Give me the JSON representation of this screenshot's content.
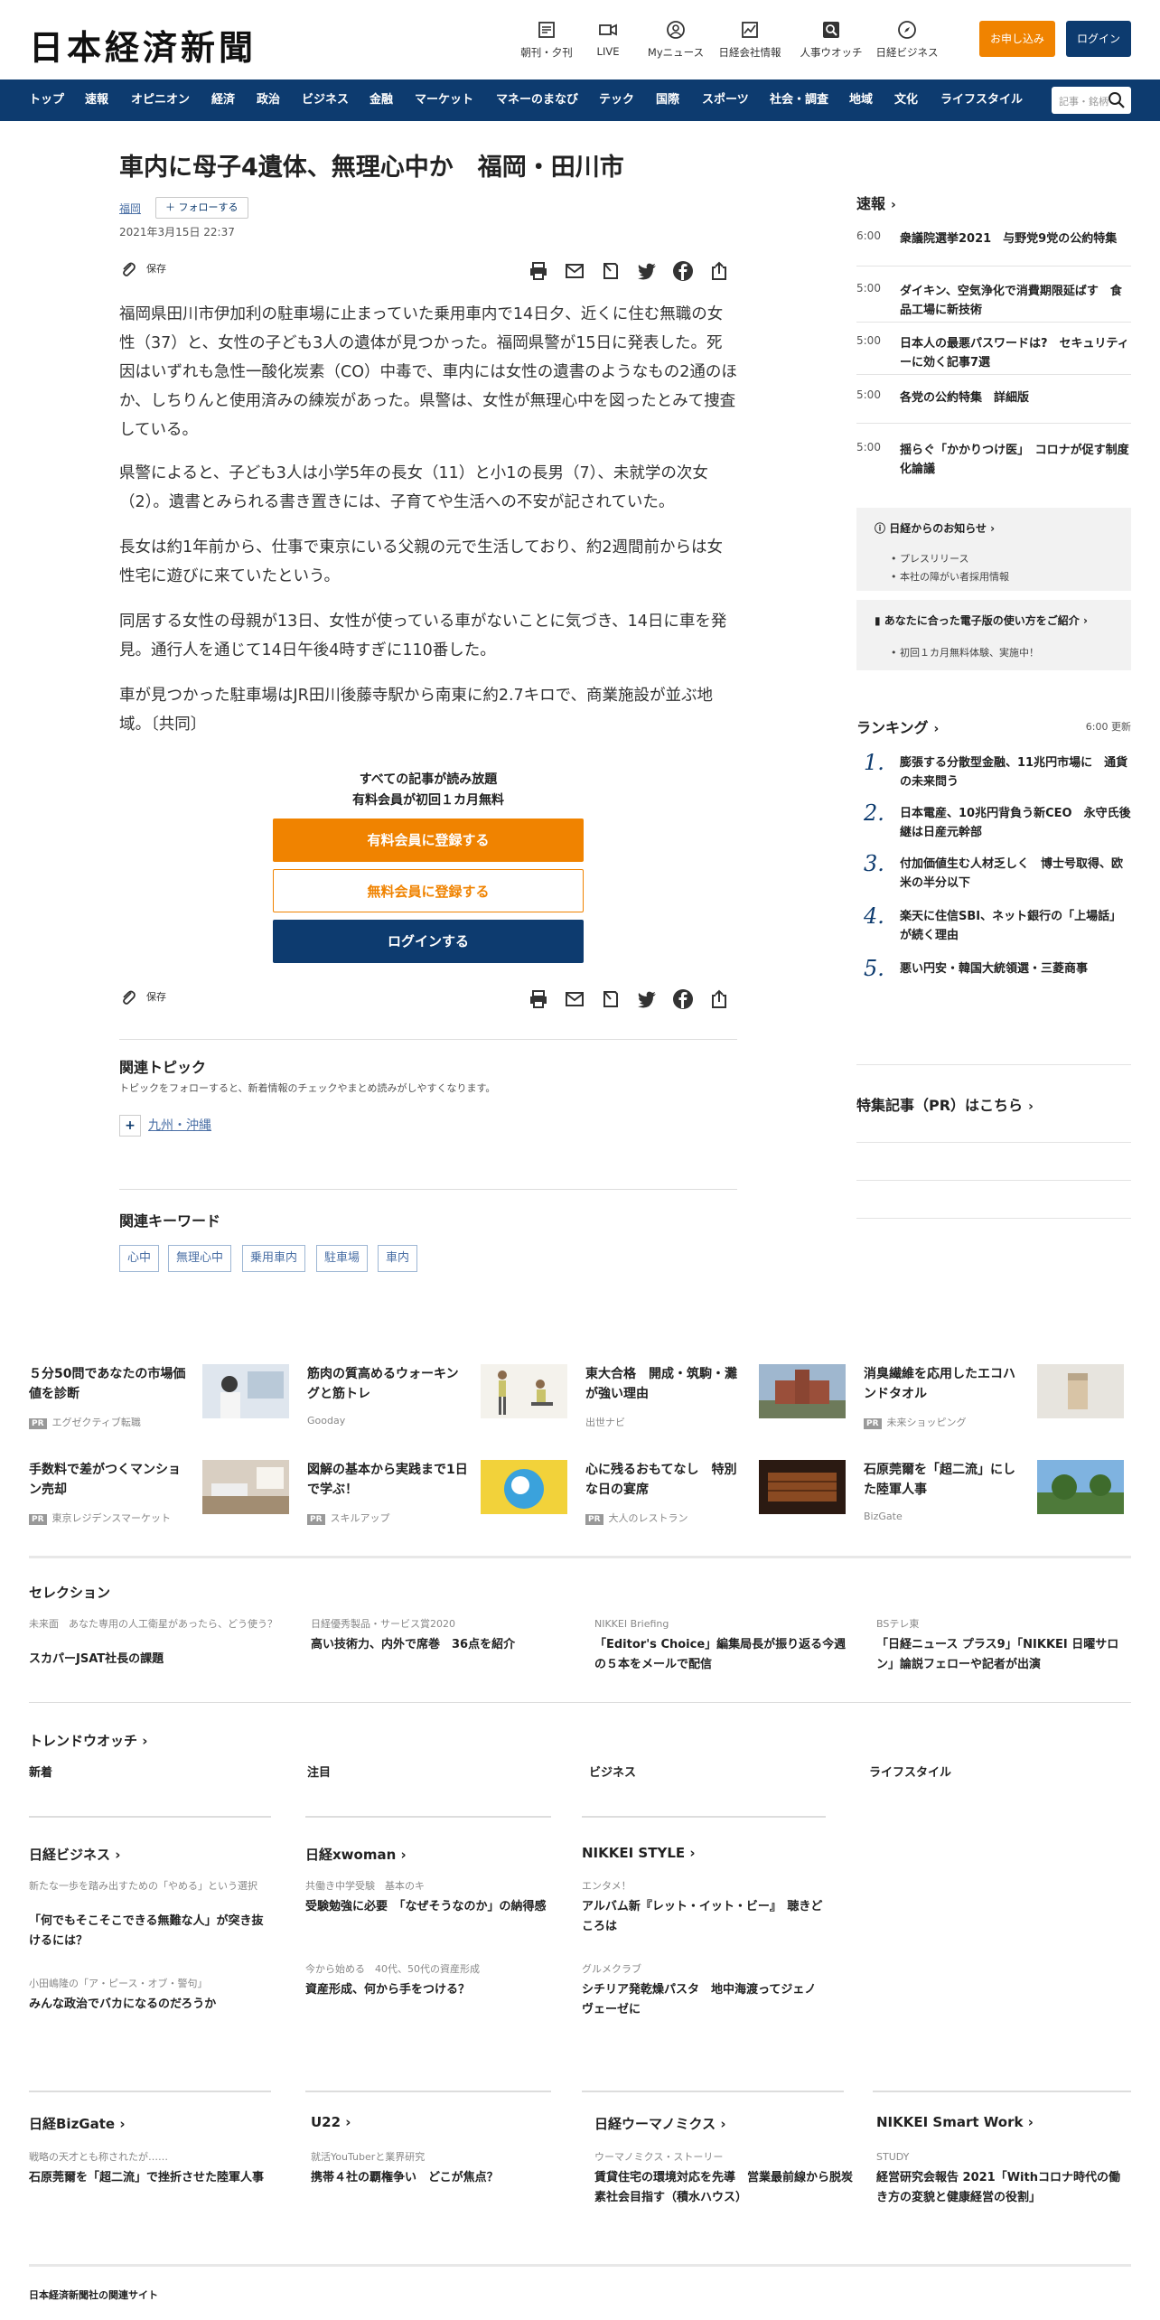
{
  "header": {
    "logo": "日本経済新聞",
    "icons": [
      {
        "label": "朝刊・夕刊",
        "icon": "newspaper-icon"
      },
      {
        "label": "LIVE",
        "icon": "video-icon"
      },
      {
        "label": "Myニュース",
        "icon": "user-icon"
      },
      {
        "label": "日経会社情報",
        "icon": "chart-icon"
      },
      {
        "label": "人事ウオッチ",
        "icon": "search-person-icon"
      },
      {
        "label": "日経ビジネス",
        "icon": "compass-icon"
      }
    ],
    "subscribe_label": "お申し込み",
    "login_label": "ログイン"
  },
  "nav": {
    "items": [
      "トップ",
      "速報",
      "オピニオン",
      "経済",
      "政治",
      "ビジネス",
      "金融",
      "マーケット",
      "マネーのまなび",
      "テック",
      "国際",
      "スポーツ",
      "社会・調査",
      "地域",
      "文化",
      "ライフスタイル"
    ],
    "search_placeholder": "記事・銘柄"
  },
  "article": {
    "title": "車内に母子4遺体、無理心中か　福岡・田川市",
    "area": "福岡",
    "follow_label": "＋ フォローする",
    "date": "2021年3月15日 22:37",
    "save_label": "保存",
    "paragraphs": [
      "福岡県田川市伊加利の駐車場に止まっていた乗用車内で14日夕、近くに住む無職の女性（37）と、女性の子ども3人の遺体が見つかった。福岡県警が15日に発表した。死因はいずれも急性一酸化炭素（CO）中毒で、車内には女性の遺書のようなもの2通のほか、しちりんと使用済みの練炭があった。県警は、女性が無理心中を図ったとみて捜査している。",
      "県警によると、子ども3人は小学5年の長女（11）と小1の長男（7）、未就学の次女（2）。遺書とみられる書き置きには、子育てや生活への不安が記されていた。",
      "長女は約1年前から、仕事で東京にいる父親の元で生活しており、約2週間前からは女性宅に遊びに来ていたという。",
      "同居する女性の母親が13日、女性が使っている車がないことに気づき、14日に車を発見。通行人を通じて14日午後4時すぎに110番した。",
      "車が見つかった駐車場はJR田川後藤寺駅から南東に約2.7キロで、商業施設が並ぶ地域。〔共同〕"
    ],
    "paywall": {
      "line1": "すべての記事が読み放題",
      "line2": "有料会員が初回１カ月無料",
      "paid_button": "有料会員に登録する",
      "free_button": "無料会員に登録する",
      "login_button": "ログインする"
    },
    "related_topic": {
      "heading": "関連トピック",
      "sub": "トピックをフォローすると、新着情報のチェックやまとめ読みがしやすくなります。",
      "topic": "九州・沖縄"
    },
    "keywords": {
      "heading": "関連キーワード",
      "items": [
        "心中",
        "無理心中",
        "乗用車内",
        "駐車場",
        "車内"
      ]
    }
  },
  "sidebar": {
    "breaking_heading": "速報",
    "breaking": [
      {
        "time": "6:00",
        "text": "衆議院選挙2021　与野党9党の公約特集"
      },
      {
        "time": "5:00",
        "text": "ダイキン、空気浄化で消費期限延ばす　食品工場に新技術"
      },
      {
        "time": "5:00",
        "text": "日本人の最悪パスワードは?　セキュリティーに効く記事7選"
      },
      {
        "time": "5:00",
        "text": "各党の公約特集　詳細版"
      },
      {
        "time": "5:00",
        "text": "揺らぐ「かかりつけ医」　コロナが促す制度化論議"
      }
    ],
    "notice": {
      "heading": "日経からのお知らせ",
      "items": [
        "プレスリリース",
        "本社の障がい者採用情報"
      ]
    },
    "ebook": {
      "heading": "あなたに合った電子版の使い方をご紹介",
      "items": [
        "初回１カ月無料体験、実施中！"
      ]
    },
    "ranking_heading": "ランキング",
    "ranking_time": "6:00 更新",
    "ranking": [
      {
        "n": "1.",
        "text": "膨張する分散型金融、11兆円市場に　通貨の未来問う"
      },
      {
        "n": "2.",
        "text": "日本電産、10兆円背負う新CEO　永守氏後継は日産元幹部"
      },
      {
        "n": "3.",
        "text": "付加価値生む人材乏しく　博士号取得、欧米の半分以下"
      },
      {
        "n": "4.",
        "text": "楽天に住信SBI、ネット銀行の「上場話」が続く理由"
      },
      {
        "n": "5.",
        "text": "悪い円安・韓国大統領選・三菱商事"
      }
    ],
    "pr_heading": "特集記事（PR）はこちら"
  },
  "ads": [
    {
      "text": "５分50問であなたの市場価値を診断",
      "source": "エグゼクティブ転職",
      "pr": true
    },
    {
      "text": "筋肉の質高めるウォーキングと筋トレ",
      "source": "Gooday",
      "pr": false
    },
    {
      "text": "東大合格　開成・筑駒・灘が強い理由",
      "source": "出世ナビ",
      "pr": false
    },
    {
      "text": "消臭繊維を応用したエコハンドタオル",
      "source": "未来ショッピング",
      "pr": true
    },
    {
      "text": "手数料で差がつくマンション売却",
      "source": "東京レジデンスマーケット",
      "pr": true
    },
    {
      "text": "図解の基本から実践まで1日で学ぶ！",
      "source": "スキルアップ",
      "pr": true
    },
    {
      "text": "心に残るおもてなし　特別な日の宴席",
      "source": "大人のレストラン",
      "pr": true
    },
    {
      "text": "石原莞爾を「超二流」にした陸軍人事",
      "source": "BizGate",
      "pr": false
    }
  ],
  "selection": {
    "heading": "セレクション",
    "items": [
      {
        "sub": "未来面　あなた専用の人工衛星があったら、どう使う？",
        "title": "スカパーJSAT社長の課題"
      },
      {
        "sub": "日経優秀製品・サービス賞2020",
        "title": "高い技術力、内外で席巻　36点を紹介"
      },
      {
        "sub": "NIKKEI Briefing",
        "title": "「Editor's Choice」編集局長が振り返る今週の５本をメールで配信"
      },
      {
        "sub": "BSテレ東",
        "title": "「日経ニュース プラス9」「NIKKEI 日曜サロン」論説フェローや記者が出演"
      }
    ]
  },
  "trend": {
    "heading": "トレンドウオッチ",
    "tabs": [
      "新着",
      "注目",
      "ビジネス",
      "ライフスタイル"
    ]
  },
  "brands1": [
    {
      "name": "日経ビジネス",
      "items": [
        {
          "sub": "新たな一歩を踏み出すための「やめる」という選択",
          "title": "「何でもそこそこできる無難な人」が突き抜けるには？"
        },
        {
          "sub": "小田嶋隆の「ア・ピース・オブ・警句」",
          "title": "みんな政治でバカになるのだろうか"
        }
      ]
    },
    {
      "name": "日経xwoman",
      "items": [
        {
          "sub": "共働き中学受験　基本のキ",
          "title": "受験勉強に必要　「なぜそうなのか」の納得感"
        },
        {
          "sub": "今から始める　40代、50代の資産形成",
          "title": "資産形成、何から手をつける？"
        }
      ]
    },
    {
      "name": "NIKKEI STYLE",
      "items": [
        {
          "sub": "エンタメ！",
          "title": "アルバム新『レット・イット・ビー』　聴きどころは"
        },
        {
          "sub": "グルメクラブ",
          "title": "シチリア発乾燥パスタ　地中海渡ってジェノヴェーゼに"
        }
      ]
    }
  ],
  "brands2": [
    {
      "name": "日経BizGate",
      "sub": "戦略の天才とも称されたが……",
      "title": "石原莞爾を「超二流」で挫折させた陸軍人事"
    },
    {
      "name": "U22",
      "sub": "就活YouTuberと業界研究",
      "title": "携帯４社の覇権争い　どこが焦点？"
    },
    {
      "name": "日経ウーマノミクス",
      "sub": "ウーマノミクス・ストーリー",
      "title": "賃貸住宅の環境対応を先導　営業最前線から脱炭素社会目指す（積水ハウス）"
    },
    {
      "name": "NIKKEI Smart Work",
      "sub": "STUDY",
      "title": "経営研究会報告 2021「Withコロナ時代の働き方の変貌と健康経営の役割」"
    }
  ],
  "footer": {
    "related_sites": "日本経済新聞社の関連サイト"
  }
}
